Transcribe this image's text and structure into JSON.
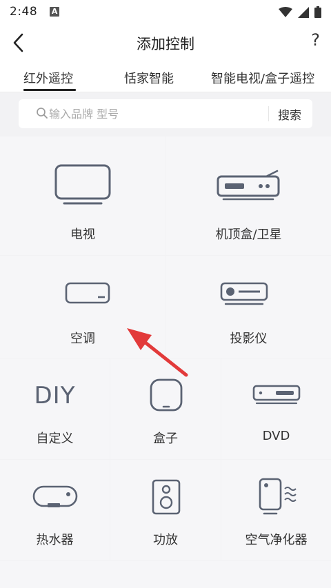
{
  "status_bar": {
    "time": "2:48",
    "notif_letter": "A"
  },
  "header": {
    "title": "添加控制",
    "help": "?"
  },
  "tabs": [
    {
      "label": "红外遥控",
      "active": true
    },
    {
      "label": "恬家智能",
      "active": false
    },
    {
      "label": "智能电视/盒子遥控",
      "active": false
    }
  ],
  "search": {
    "placeholder": "输入品牌 型号",
    "value": "",
    "button": "搜索"
  },
  "devices": {
    "tv": "电视",
    "stb": "机顶盒/卫星",
    "ac": "空调",
    "projector": "投影仪",
    "diy": "自定义",
    "diy_icon_text": "DIY",
    "box": "盒子",
    "dvd": "DVD",
    "water_heater": "热水器",
    "amplifier": "功放",
    "air_purifier": "空气净化器"
  },
  "colors": {
    "icon": "#5b6373",
    "accent": "#e23a3a",
    "bg": "#f2f2f4"
  }
}
